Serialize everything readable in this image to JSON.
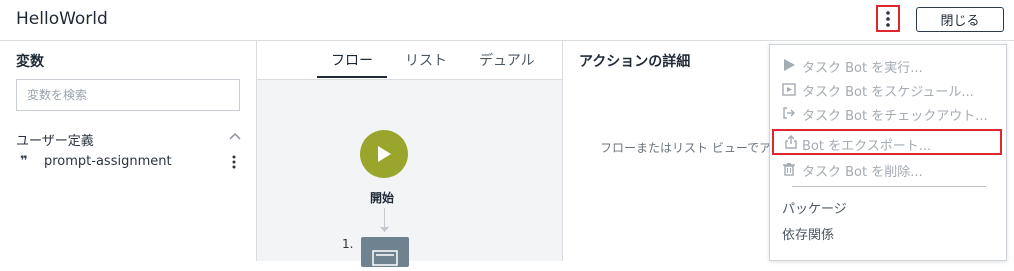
{
  "header": {
    "title": "HelloWorld",
    "close_label": "閉じる"
  },
  "variables": {
    "title": "変数",
    "search_placeholder": "変数を検索",
    "section_label": "ユーザー定義",
    "items": [
      {
        "name": "prompt-assignment",
        "icon": "quote-icon"
      }
    ]
  },
  "tabs": [
    {
      "label": "フロー",
      "active": true
    },
    {
      "label": "リスト",
      "active": false
    },
    {
      "label": "デュアル",
      "active": false
    }
  ],
  "flow": {
    "start_label": "開始",
    "step_number": "1."
  },
  "details": {
    "title": "アクションの詳細",
    "hint": "フローまたはリスト ビューでア"
  },
  "menu": {
    "items": [
      {
        "label": "タスク Bot を実行...",
        "icon": "play-icon",
        "disabled": true
      },
      {
        "label": "タスク Bot をスケジュール...",
        "icon": "schedule-play-icon",
        "disabled": true
      },
      {
        "label": "タスク Bot をチェックアウト...",
        "icon": "checkout-icon",
        "disabled": true
      },
      {
        "label": "Bot をエクスポート...",
        "icon": "export-icon",
        "disabled": true,
        "highlighted": true
      },
      {
        "label": "タスク Bot を削除...",
        "icon": "trash-icon",
        "disabled": true
      }
    ],
    "extra": [
      "パッケージ",
      "依存関係"
    ]
  },
  "colors": {
    "accent_start": "#9aa62b",
    "highlight_border": "#e0262e",
    "disabled_text": "#a3abb3"
  }
}
